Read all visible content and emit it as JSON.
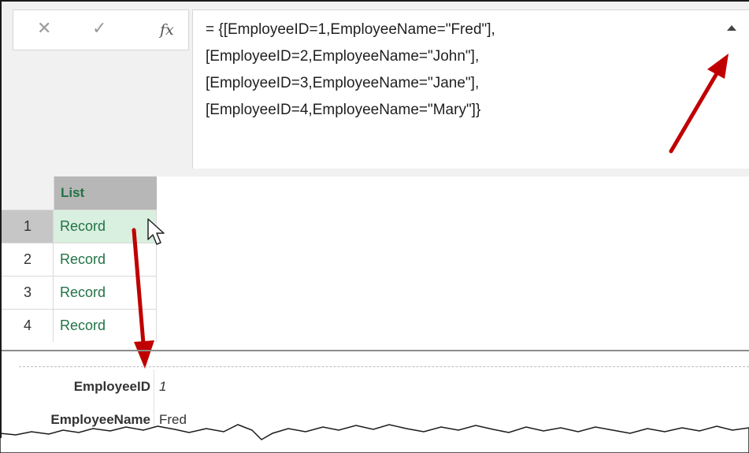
{
  "formula_bar": {
    "cancel_icon": "close-icon",
    "commit_icon": "checkmark-icon",
    "fx_label": "fx",
    "lines": [
      "= {[EmployeeID=1,EmployeeName=\"Fred\"],",
      "[EmployeeID=2,EmployeeName=\"John\"],",
      "[EmployeeID=3,EmployeeName=\"Jane\"],",
      "[EmployeeID=4,EmployeeName=\"Mary\"]}"
    ],
    "collapse_icon": "chevron-up-icon"
  },
  "grid": {
    "column_header": "List",
    "rows": [
      {
        "num": "1",
        "value": "Record",
        "selected": true
      },
      {
        "num": "2",
        "value": "Record",
        "selected": false
      },
      {
        "num": "3",
        "value": "Record",
        "selected": false
      },
      {
        "num": "4",
        "value": "Record",
        "selected": false
      }
    ]
  },
  "preview": {
    "fields": [
      {
        "key": "EmployeeID",
        "value": "1"
      },
      {
        "key": "EmployeeName",
        "value": "Fred"
      }
    ]
  },
  "colors": {
    "accent_green": "#217346",
    "selected_cell": "#d9efdf",
    "annotation_arrow": "#c00000"
  }
}
